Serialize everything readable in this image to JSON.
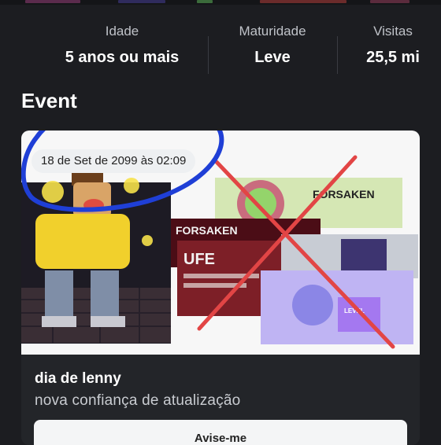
{
  "stats": [
    {
      "label": "Idade",
      "value": "5 anos ou mais"
    },
    {
      "label": "Maturidade",
      "value": "Leve"
    },
    {
      "label": "Visitas",
      "value": "25,5 mi"
    }
  ],
  "section": {
    "title": "Event"
  },
  "event": {
    "date": "18 de Set de 2099 às 02:09",
    "title": "dia de lenny",
    "subtitle": "nova confiança de atualização",
    "button_label": "Avise-me",
    "thumbnail_texts": {
      "sticker_1": "FORSAKEN",
      "sticker_2": "FORSAKEN",
      "sticker_3": "UFE",
      "badge": "LEVEL"
    }
  },
  "colors": {
    "background": "#1c1d21",
    "card": "#232529",
    "annotation_circle": "#1f3fd6",
    "cross": "#e24545"
  }
}
